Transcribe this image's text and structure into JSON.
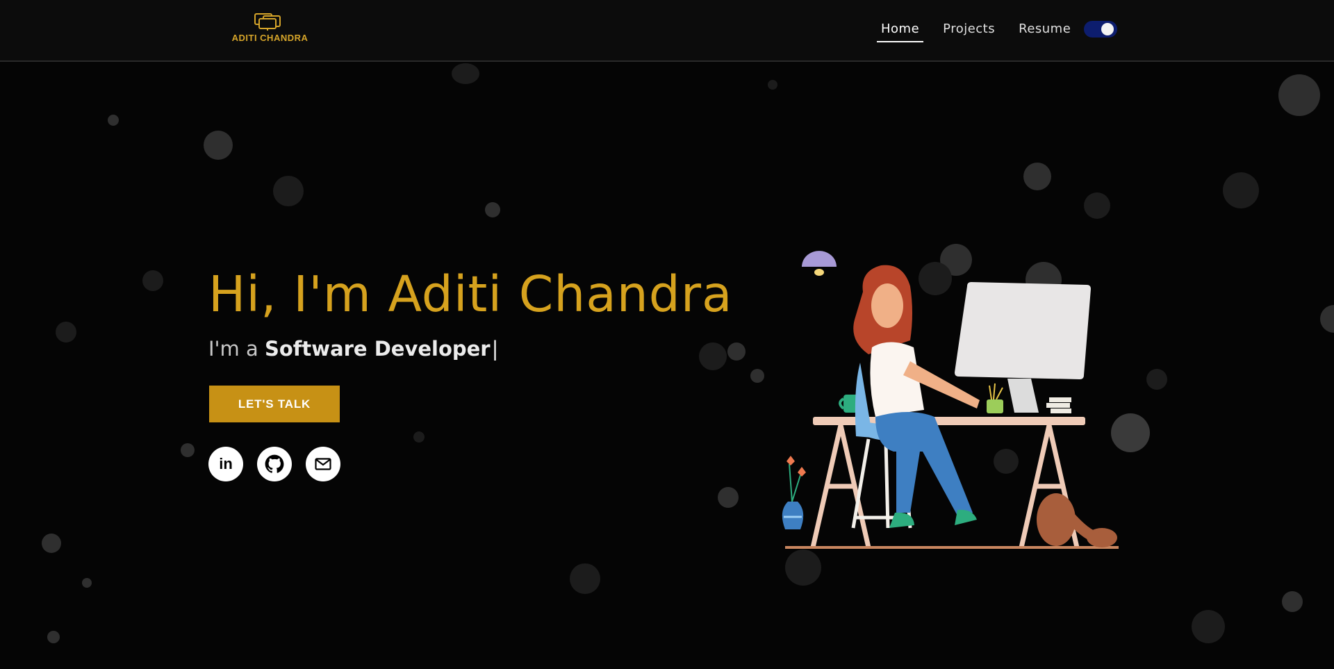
{
  "header": {
    "logo_text": "ADITI CHANDRA",
    "nav": [
      {
        "label": "Home",
        "active": true
      },
      {
        "label": "Projects",
        "active": false
      },
      {
        "label": "Resume",
        "active": false
      }
    ],
    "theme_toggle": {
      "state": "on",
      "icon": "toggle-switch-icon"
    }
  },
  "hero": {
    "title": "Hi, I'm Aditi Chandra",
    "subtitle_prefix": "I'm a ",
    "subtitle_role": "Software Developer",
    "cursor": "|",
    "cta_label": "LET'S TALK",
    "social": [
      {
        "name": "linkedin",
        "icon": "linkedin-icon",
        "glyph": "in"
      },
      {
        "name": "github",
        "icon": "github-icon"
      },
      {
        "name": "email",
        "icon": "mail-icon"
      }
    ]
  },
  "colors": {
    "background": "#050505",
    "header": "#0c0c0c",
    "accent": "#d6a21e",
    "button": "#c79115",
    "toggle": "#0d1d6e"
  }
}
